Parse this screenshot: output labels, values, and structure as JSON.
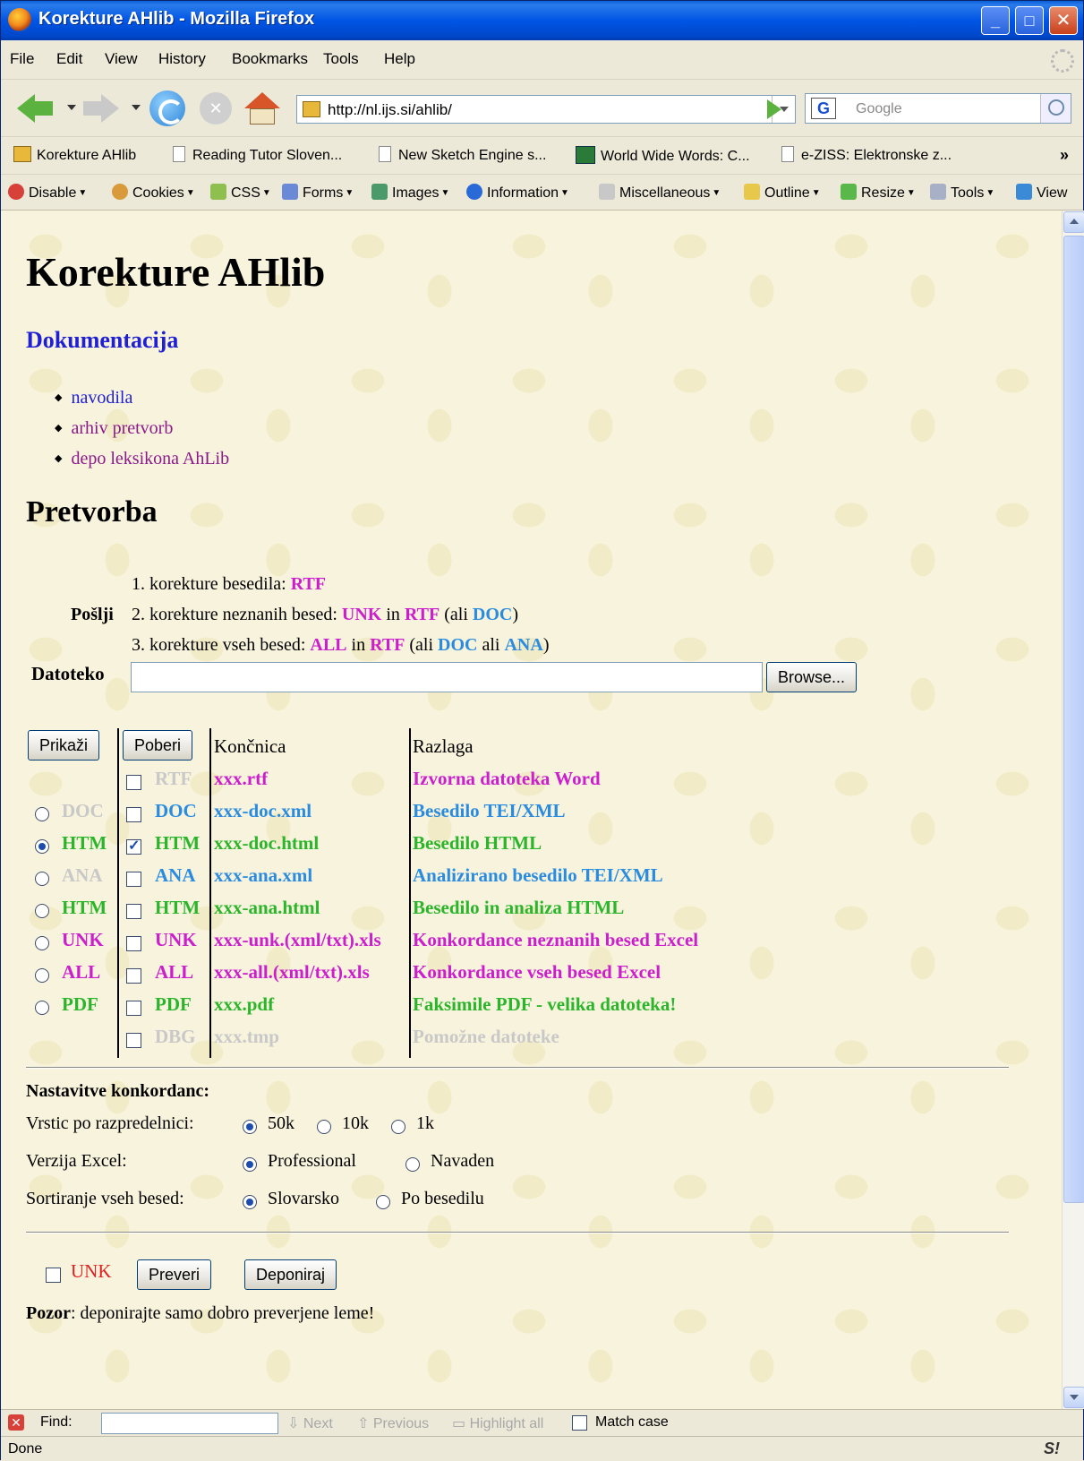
{
  "window": {
    "title": "Korekture AHlib - Mozilla Firefox"
  },
  "menu": [
    "File",
    "Edit",
    "View",
    "History",
    "Bookmarks",
    "Tools",
    "Help"
  ],
  "nav": {
    "url": "http://nl.ijs.si/ahlib/",
    "search_placeholder": "Google"
  },
  "bookmarks": [
    "Korekture AHlib",
    "Reading Tutor Sloven...",
    "New Sketch Engine s...",
    "World Wide Words: C...",
    "e-ZISS: Elektronske z..."
  ],
  "bookmarks_more": "»",
  "webdev": [
    "Disable",
    "Cookies",
    "CSS",
    "Forms",
    "Images",
    "Information",
    "Miscellaneous",
    "Outline",
    "Resize",
    "Tools",
    "View"
  ],
  "page": {
    "title": "Korekture AHlib",
    "doc_heading": "Dokumentacija",
    "links": [
      "navodila",
      "arhiv pretvorb",
      "depo leksikona AhLib"
    ],
    "convert_heading": "Pretvorba",
    "send_label": "Pošlji",
    "send_lines": [
      {
        "prefix": "1. korekture besedila: ",
        "parts": [
          {
            "t": "RTF",
            "c": "mag"
          }
        ]
      },
      {
        "prefix": "2. korekture neznanih besed: ",
        "parts": [
          {
            "t": "UNK",
            "c": "mag"
          },
          {
            "t": " in ",
            "c": ""
          },
          {
            "t": "RTF",
            "c": "mag"
          },
          {
            "t": " (ali ",
            "c": ""
          },
          {
            "t": "DOC",
            "c": "cyan"
          },
          {
            "t": ")",
            "c": ""
          }
        ]
      },
      {
        "prefix": "3. korekture vseh besed: ",
        "parts": [
          {
            "t": "ALL",
            "c": "mag"
          },
          {
            "t": " in ",
            "c": ""
          },
          {
            "t": "RTF",
            "c": "mag"
          },
          {
            "t": " (ali ",
            "c": ""
          },
          {
            "t": "DOC",
            "c": "cyan"
          },
          {
            "t": " ali ",
            "c": ""
          },
          {
            "t": "ANA",
            "c": "cyan"
          },
          {
            "t": ")",
            "c": ""
          }
        ]
      }
    ],
    "file_label": "Datoteko",
    "browse_label": "Browse...",
    "show_button": "Prikaži",
    "fetch_button": "Poberi",
    "col_ext": "Končnica",
    "col_desc": "Razlaga",
    "rows": [
      {
        "radio": null,
        "radio_label": "",
        "radio_on": false,
        "cb_label": "RTF",
        "cb_on": false,
        "color": "gray",
        "ext": "xxx.rtf",
        "ext_color": "mag",
        "desc": "Izvorna datoteka Word",
        "desc_color": "mag"
      },
      {
        "radio": true,
        "radio_label": "DOC",
        "radio_on": false,
        "radio_color": "gray",
        "cb_label": "DOC",
        "cb_on": false,
        "color": "cyan",
        "ext": "xxx-doc.xml",
        "ext_color": "cyan",
        "desc": "Besedilo TEI/XML",
        "desc_color": "cyan"
      },
      {
        "radio": true,
        "radio_label": "HTM",
        "radio_on": true,
        "radio_color": "grn",
        "cb_label": "HTM",
        "cb_on": true,
        "color": "grn",
        "ext": "xxx-doc.html",
        "ext_color": "grn",
        "desc": "Besedilo HTML",
        "desc_color": "grn"
      },
      {
        "radio": true,
        "radio_label": "ANA",
        "radio_on": false,
        "radio_color": "gray",
        "cb_label": "ANA",
        "cb_on": false,
        "color": "cyan",
        "ext": "xxx-ana.xml",
        "ext_color": "cyan",
        "desc": "Analizirano besedilo TEI/XML",
        "desc_color": "cyan"
      },
      {
        "radio": true,
        "radio_label": "HTM",
        "radio_on": false,
        "radio_color": "grn",
        "cb_label": "HTM",
        "cb_on": false,
        "color": "grn",
        "ext": "xxx-ana.html",
        "ext_color": "grn",
        "desc": "Besedilo in analiza HTML",
        "desc_color": "grn"
      },
      {
        "radio": true,
        "radio_label": "UNK",
        "radio_on": false,
        "radio_color": "mag",
        "cb_label": "UNK",
        "cb_on": false,
        "color": "mag",
        "ext": "xxx-unk.(xml/txt).xls",
        "ext_color": "mag",
        "desc": "Konkordance neznanih besed Excel",
        "desc_color": "mag"
      },
      {
        "radio": true,
        "radio_label": "ALL",
        "radio_on": false,
        "radio_color": "mag",
        "cb_label": "ALL",
        "cb_on": false,
        "color": "mag",
        "ext": "xxx-all.(xml/txt).xls",
        "ext_color": "mag",
        "desc": "Konkordance vseh besed Excel",
        "desc_color": "mag"
      },
      {
        "radio": true,
        "radio_label": "PDF",
        "radio_on": false,
        "radio_color": "grn",
        "cb_label": "PDF",
        "cb_on": false,
        "color": "grn",
        "ext": "xxx.pdf",
        "ext_color": "grn",
        "desc": "Faksimile PDF - velika datoteka!",
        "desc_color": "grn"
      },
      {
        "radio": null,
        "radio_label": "",
        "radio_on": false,
        "cb_label": "DBG",
        "cb_on": false,
        "color": "gray",
        "ext": "xxx.tmp",
        "ext_color": "gray",
        "desc": "Pomožne datoteke",
        "desc_color": "gray"
      }
    ],
    "settings_heading": "Nastavitve konkordanc:",
    "settings": [
      {
        "label": "Vrstic po razpredelnici:",
        "options": [
          {
            "t": "50k",
            "on": true
          },
          {
            "t": "10k",
            "on": false
          },
          {
            "t": "1k",
            "on": false
          }
        ]
      },
      {
        "label": "Verzija Excel:",
        "options": [
          {
            "t": "Professional",
            "on": true
          },
          {
            "t": "Navaden",
            "on": false
          }
        ]
      },
      {
        "label": "Sortiranje vseh besed:",
        "options": [
          {
            "t": "Slovarsko",
            "on": true
          },
          {
            "t": "Po besedilu",
            "on": false
          }
        ]
      }
    ],
    "unk_label": "UNK",
    "check_button": "Preveri",
    "deposit_button": "Deponiraj",
    "warning_bold": "Pozor",
    "warning_text": ": deponirajte samo dobro preverjene leme!"
  },
  "findbar": {
    "label": "Find:",
    "next": "Next",
    "previous": "Previous",
    "highlight": "Highlight all",
    "match_case": "Match case"
  },
  "status": {
    "text": "Done"
  },
  "colors": {
    "magenta": "#cc1ecc",
    "cyan": "#2a8ce0",
    "green": "#2ab52a",
    "gray": "#c8c8c8",
    "link_blue": "#1f1fd4",
    "link_visited": "#8a1a8a",
    "title_bar": "#0055e5"
  }
}
